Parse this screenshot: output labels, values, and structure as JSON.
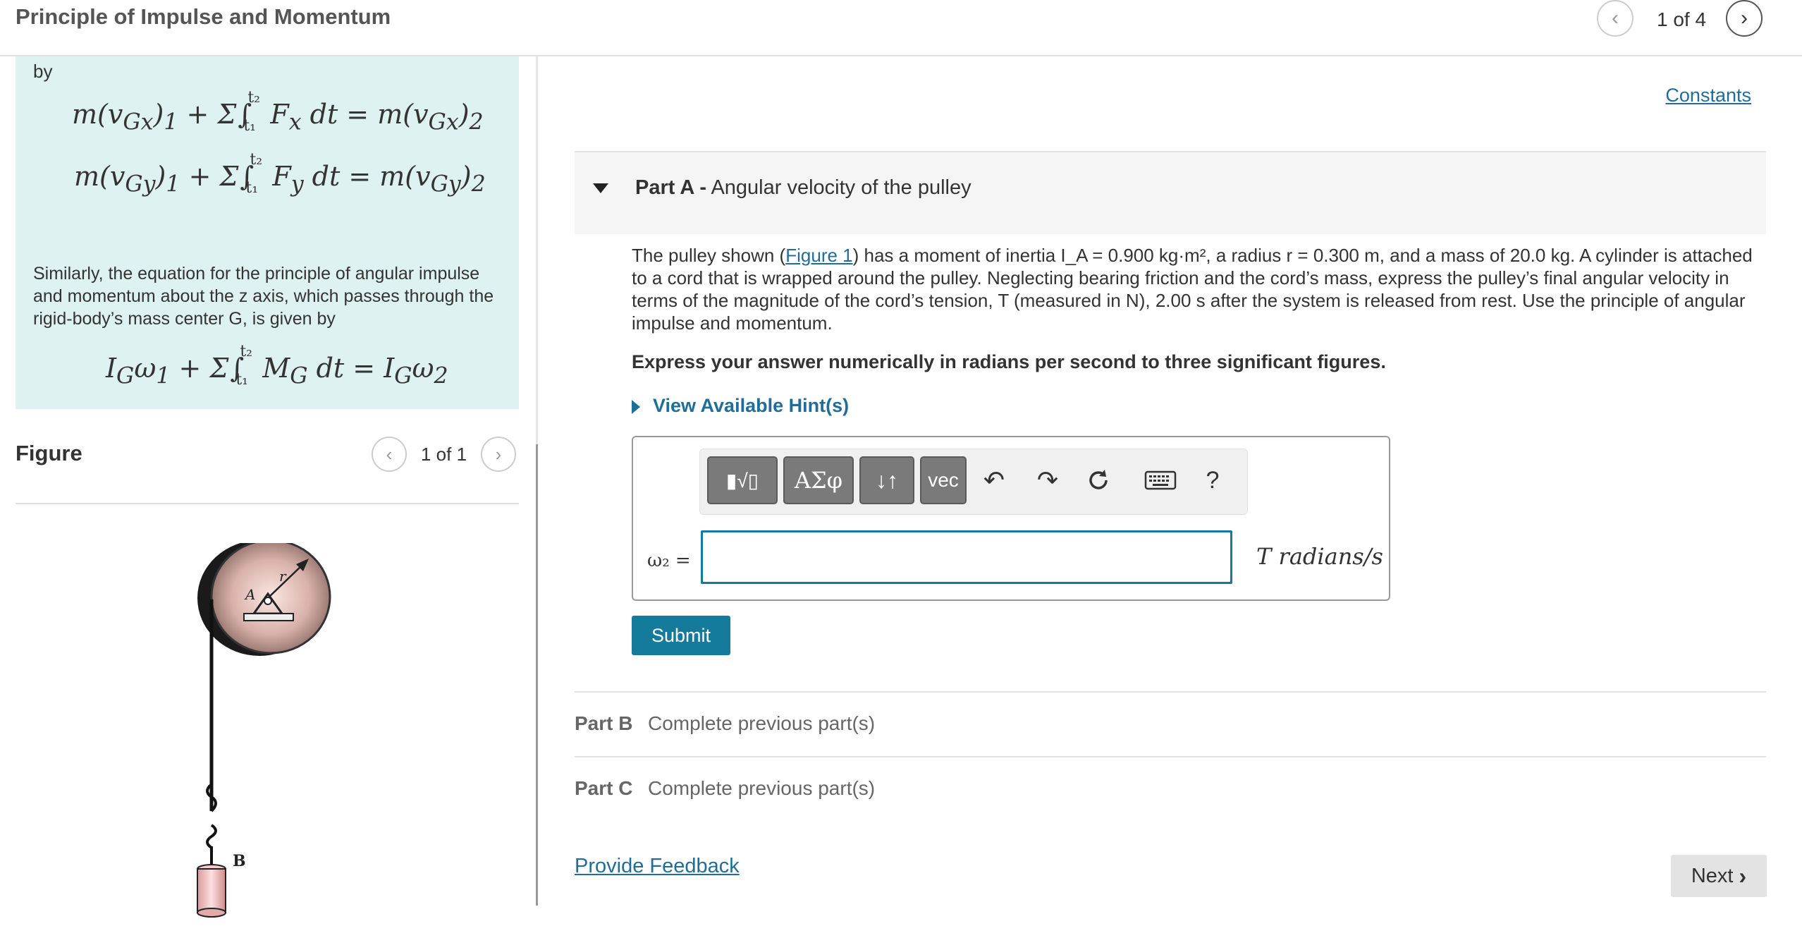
{
  "header": {
    "title": "Principle of Impulse and Momentum",
    "page_indicator": "1 of 4",
    "prev_icon": "chevron-left-icon",
    "next_icon": "chevron-right-icon"
  },
  "explanation": {
    "by_text": "by",
    "para": "Similarly, the equation for the principle of angular impulse and momentum about the z axis, which passes through the rigid-body’s mass center G, is given by"
  },
  "figure": {
    "label": "Figure",
    "page_indicator": "1 of 1",
    "label_r": "r",
    "label_a": "A",
    "label_b": "B"
  },
  "constants_link": "Constants",
  "partA": {
    "label": "Part A -",
    "title": "Angular velocity of the pulley",
    "problem_pre": "The pulley shown (",
    "figure_link": "Figure 1",
    "problem_post": ") has a moment of inertia I_A = 0.900 kg·m², a radius r = 0.300 m, and a mass of 20.0 kg. A cylinder is attached to a cord that is wrapped around the pulley. Neglecting bearing friction and the cord’s mass, express the pulley’s final angular velocity in terms of the magnitude of the cord’s tension, T (measured in N), 2.00 s after the system is released from rest. Use the principle of angular impulse and momentum.",
    "instruction": "Express your answer numerically in radians per second to three significant figures.",
    "hint_link": "View Available Hint(s)",
    "answer_label": "ω₂ =",
    "answer_value": "",
    "units": "T radians/s",
    "submit_label": "Submit"
  },
  "toolbar": {
    "greek_label": "ΑΣφ",
    "arrows_label": "↓↑",
    "vec_label": "vec",
    "undo_icon": "↶",
    "redo_icon": "↷",
    "help_label": "?"
  },
  "partB": {
    "label": "Part B",
    "status": "Complete previous part(s)"
  },
  "partC": {
    "label": "Part C",
    "status": "Complete previous part(s)"
  },
  "footer": {
    "feedback_link": "Provide Feedback",
    "next_label": "Next"
  },
  "colors": {
    "accent": "#147b9d",
    "link": "#1f6e9a",
    "explain_bg": "#dff2f2"
  }
}
